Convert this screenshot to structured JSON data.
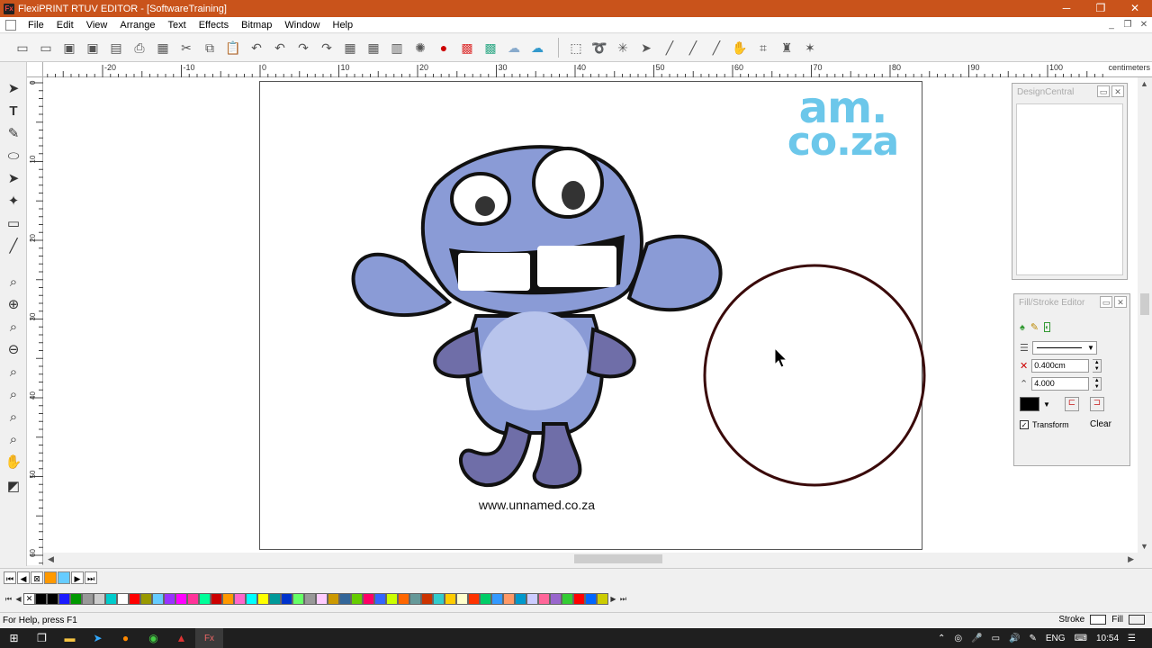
{
  "window": {
    "title": "FlexiPRINT RTUV EDITOR - [SoftwareTraining]",
    "app_icon_label": "Fx",
    "minimize": "─",
    "maximize": "❐",
    "close": "✕"
  },
  "menu": {
    "items": [
      "File",
      "Edit",
      "View",
      "Arrange",
      "Text",
      "Effects",
      "Bitmap",
      "Window",
      "Help"
    ]
  },
  "ruler": {
    "labels": [
      "-20",
      "-10",
      "0",
      "10",
      "20",
      "30",
      "40",
      "50",
      "60",
      "70",
      "80",
      "90",
      "100"
    ],
    "unit": "centimeters",
    "vertical_labels": [
      "0",
      "10",
      "20",
      "30",
      "40",
      "50",
      "60"
    ]
  },
  "canvas": {
    "logo_line1": "am.",
    "logo_line2": "co.za",
    "website": "www.unnamed.co.za"
  },
  "panels": {
    "design_central": {
      "title": "DesignCentral"
    },
    "fill_stroke": {
      "title": "Fill/Stroke Editor",
      "width_value": "0.400cm",
      "miter_value": "4.000",
      "transform_label": "Transform",
      "transform_checked": true,
      "clear_label": "Clear"
    }
  },
  "palette": {
    "colors": [
      "#000000",
      "#000000",
      "#1a1aff",
      "#009900",
      "#999999",
      "#cccccc",
      "#00cccc",
      "#ffffff",
      "#ff0000",
      "#999900",
      "#66ccff",
      "#9933ff",
      "#ff00ff",
      "#ff3399",
      "#00ff99",
      "#cc0000",
      "#ff9900",
      "#ff66cc",
      "#00ffff",
      "#ffff00",
      "#009999",
      "#0033cc",
      "#66ff66",
      "#999999",
      "#ffccff",
      "#cc9900",
      "#336699",
      "#66cc00",
      "#ff0066",
      "#3366ff",
      "#ccff00",
      "#ff6600",
      "#669999",
      "#cc3300",
      "#33cccc",
      "#ffcc00",
      "#ffffcc",
      "#ff3300",
      "#00cc66",
      "#3399ff",
      "#ff9966",
      "#0099cc",
      "#ccccff",
      "#ff6699",
      "#9966cc",
      "#33cc33",
      "#ff0000",
      "#0066ff",
      "#cccc00"
    ]
  },
  "status": {
    "help_text": "For Help, press F1",
    "stroke_label": "Stroke",
    "fill_label": "Fill"
  },
  "taskbar": {
    "language": "ENG",
    "time": "10:54",
    "app_label": "Fx"
  },
  "colors": {
    "titlebar": "#c9531b",
    "logo": "#6cc7ea",
    "circle_stroke": "#3a0a0a",
    "mascot": "#8a9bd6"
  }
}
